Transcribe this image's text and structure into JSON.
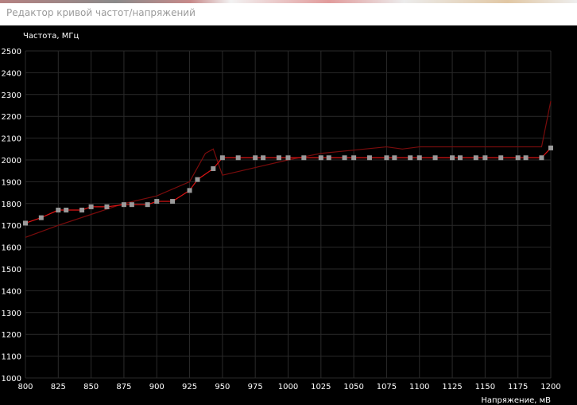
{
  "window": {
    "title": "Редактор кривой частот/напряжений"
  },
  "chart_data": {
    "type": "line",
    "ylabel": "Частота, МГц",
    "xlabel": "Напряжение, мВ",
    "xlim": [
      800,
      1200
    ],
    "ylim": [
      1000,
      2500
    ],
    "x_ticks": [
      800,
      825,
      850,
      875,
      900,
      925,
      950,
      975,
      1000,
      1025,
      1050,
      1075,
      1100,
      1125,
      1150,
      1175,
      1200
    ],
    "y_ticks": [
      1000,
      1100,
      1200,
      1300,
      1400,
      1500,
      1600,
      1700,
      1800,
      1900,
      2000,
      2100,
      2200,
      2300,
      2400,
      2500
    ],
    "grid": true,
    "colors": {
      "background": "#000000",
      "grid": "#2a2a2a",
      "curve": "#e01414",
      "reference_curve": "#7a0c0c",
      "points": "#9a9a9a",
      "text": "#ffffff"
    },
    "series": [
      {
        "x": [
          800,
          812,
          825,
          831,
          843,
          850,
          862,
          875,
          881,
          893,
          900,
          912,
          925,
          931,
          943,
          950,
          962,
          975,
          981,
          993,
          1000,
          1012,
          1025,
          1031,
          1043,
          1050,
          1062,
          1075,
          1081,
          1093,
          1100,
          1112,
          1125,
          1131,
          1143,
          1150,
          1162,
          1175,
          1181,
          1193,
          1200
        ],
        "values": [
          1710,
          1735,
          1770,
          1770,
          1770,
          1785,
          1785,
          1795,
          1795,
          1795,
          1810,
          1810,
          1860,
          1910,
          1960,
          2010,
          2010,
          2010,
          2010,
          2010,
          2010,
          2010,
          2010,
          2010,
          2010,
          2010,
          2010,
          2010,
          2010,
          2010,
          2010,
          2010,
          2010,
          2010,
          2010,
          2010,
          2010,
          2010,
          2010,
          2010,
          2055
        ]
      },
      {
        "x": [
          800,
          825,
          850,
          875,
          900,
          925,
          937,
          943,
          950,
          975,
          1000,
          1025,
          1050,
          1075,
          1087,
          1100,
          1125,
          1150,
          1175,
          1193,
          1200
        ],
        "values": [
          1645,
          1700,
          1750,
          1800,
          1835,
          1900,
          2030,
          2050,
          1930,
          1965,
          2000,
          2030,
          2045,
          2060,
          2050,
          2060,
          2060,
          2060,
          2060,
          2060,
          2270
        ]
      }
    ]
  }
}
